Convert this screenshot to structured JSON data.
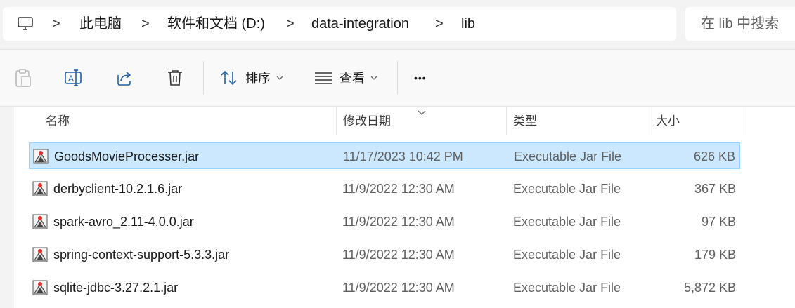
{
  "breadcrumb": {
    "items": [
      "此电脑",
      "软件和文档 (D:)",
      "data-integration",
      "lib"
    ],
    "separator": ">"
  },
  "search": {
    "placeholder": "在 lib 中搜索"
  },
  "toolbar": {
    "sort_label": "排序",
    "view_label": "查看",
    "more_label": "•••",
    "icons": [
      "paste-icon",
      "rename-icon",
      "share-icon",
      "delete-icon",
      "sort-icon",
      "view-icon"
    ]
  },
  "columns": {
    "name": "名称",
    "date": "修改日期",
    "type": "类型",
    "size": "大小"
  },
  "files": [
    {
      "name": "GoodsMovieProcesser.jar",
      "date": "11/17/2023 10:42 PM",
      "type": "Executable Jar File",
      "size": "626 KB",
      "selected": true
    },
    {
      "name": "derbyclient-10.2.1.6.jar",
      "date": "11/9/2022 12:30 AM",
      "type": "Executable Jar File",
      "size": "367 KB",
      "selected": false
    },
    {
      "name": "spark-avro_2.11-4.0.0.jar",
      "date": "11/9/2022 12:30 AM",
      "type": "Executable Jar File",
      "size": "97 KB",
      "selected": false
    },
    {
      "name": "spring-context-support-5.3.3.jar",
      "date": "11/9/2022 12:30 AM",
      "type": "Executable Jar File",
      "size": "179 KB",
      "selected": false
    },
    {
      "name": "sqlite-jdbc-3.27.2.1.jar",
      "date": "11/9/2022 12:30 AM",
      "type": "Executable Jar File",
      "size": "5,872 KB",
      "selected": false
    }
  ],
  "colors": {
    "selection": "#cce8ff",
    "selection_border": "#99d1ff",
    "background": "#f3f3f3"
  }
}
